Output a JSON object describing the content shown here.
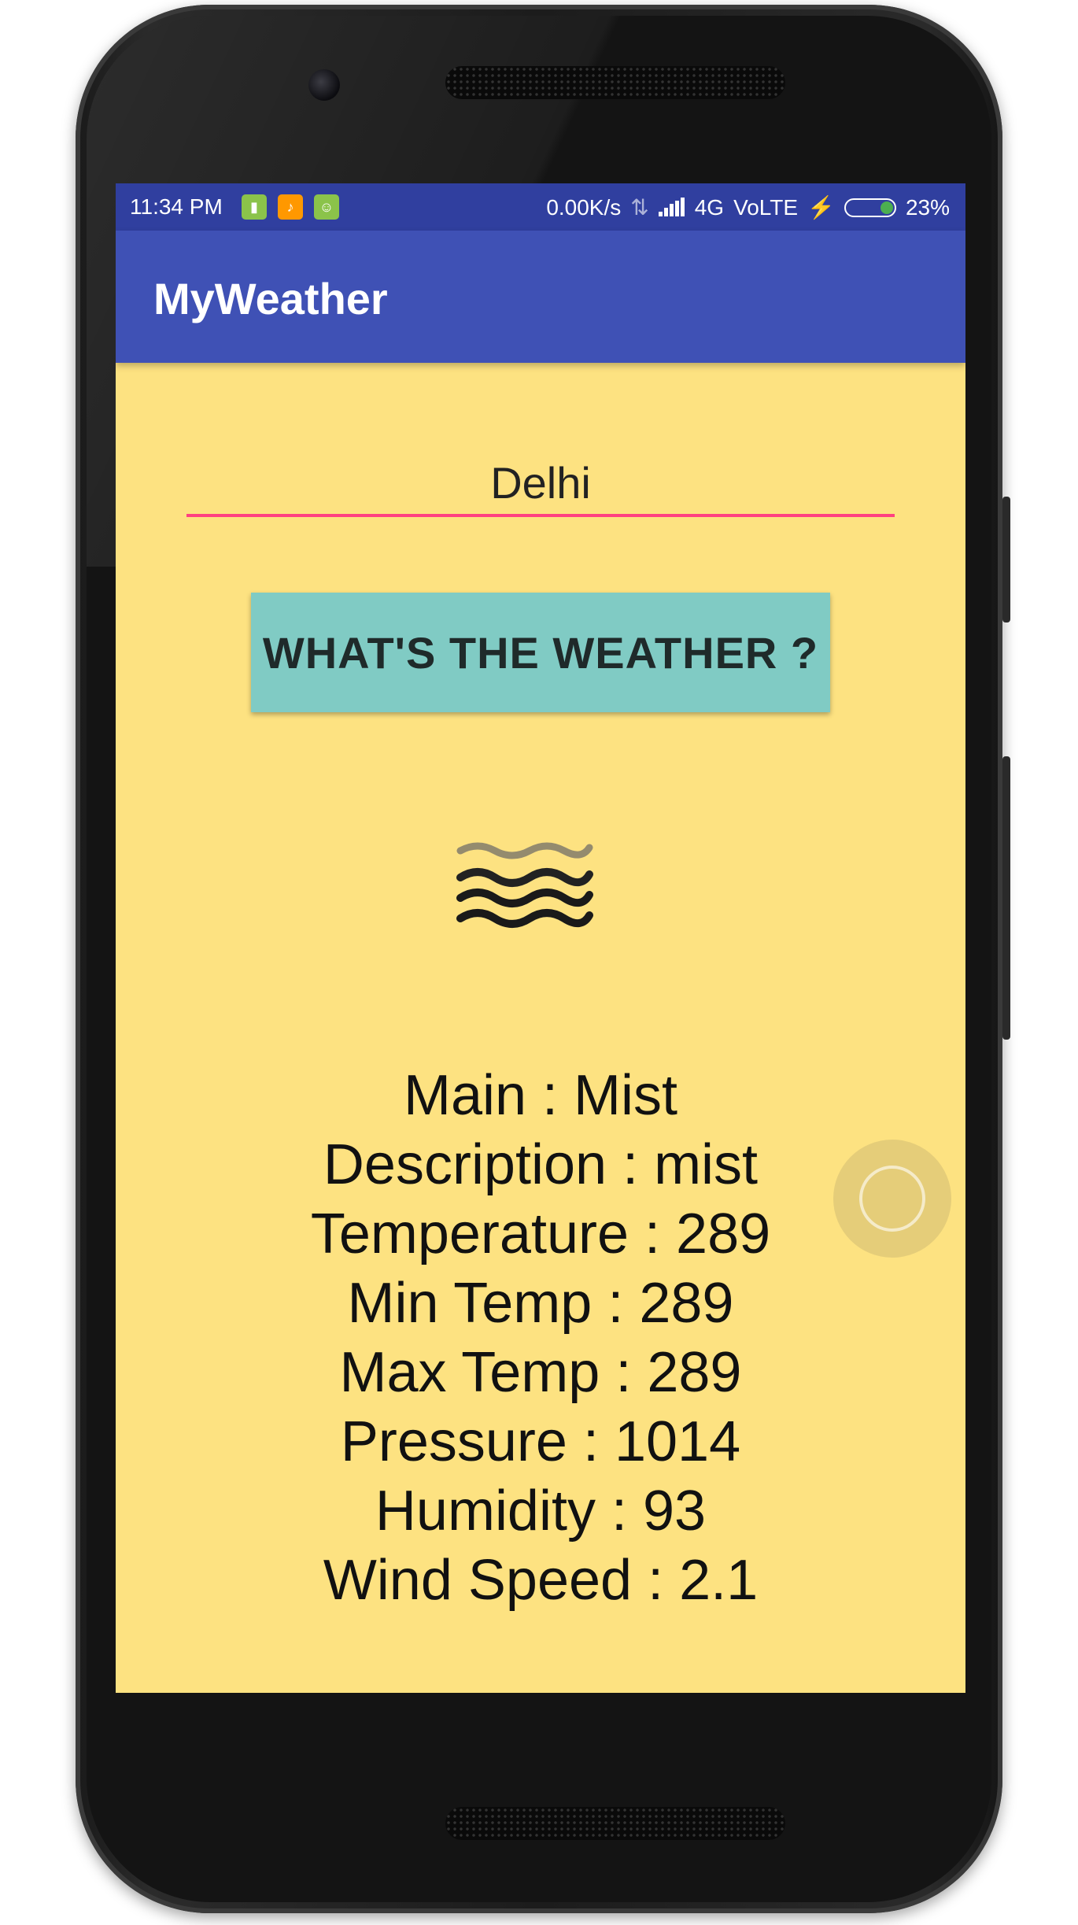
{
  "status_bar": {
    "time": "11:34 PM",
    "net_speed": "0.00K/s",
    "network": "4G",
    "volte": "VoLTE",
    "battery": "23%",
    "notification_icons": [
      "battery-app-icon",
      "music-icon",
      "cat-app-icon"
    ]
  },
  "app_bar": {
    "title": "MyWeather"
  },
  "search": {
    "city_value": "Delhi"
  },
  "action": {
    "button_label": "WHAT'S THE WEATHER ?"
  },
  "weather_icon": "mist-icon",
  "info": {
    "main": "Main : Mist",
    "description": "Description : mist",
    "temperature": "Temperature : 289",
    "min_temp": "Min Temp : 289",
    "max_temp": "Max Temp : 289",
    "pressure": "Pressure : 1014",
    "humidity": "Humidity : 93",
    "wind_speed": "Wind Speed : 2.1"
  },
  "colors": {
    "status_bar": "#303f9f",
    "app_bar": "#3f51b5",
    "background": "#fde281",
    "input_underline": "#ff4081",
    "button": "#80cbc4"
  }
}
